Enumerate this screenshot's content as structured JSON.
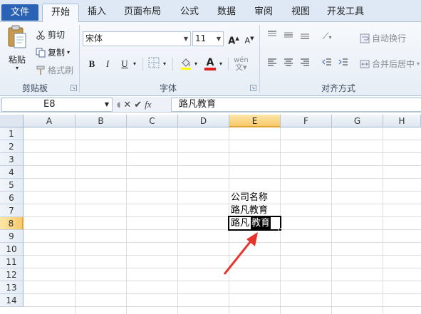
{
  "tabs": {
    "file": "文件",
    "home": "开始",
    "insert": "插入",
    "page_layout": "页面布局",
    "formulas": "公式",
    "data": "数据",
    "review": "审阅",
    "view": "视图",
    "developer": "开发工具"
  },
  "clipboard": {
    "paste": "粘贴",
    "cut": "剪切",
    "copy": "复制",
    "format_painter": "格式刷",
    "group_label": "剪贴板"
  },
  "font": {
    "name": "宋体",
    "size": "11",
    "group_label": "字体",
    "bold": "B",
    "italic": "I",
    "underline": "U",
    "grow": "A",
    "shrink": "A",
    "font_color_accent": "#e02020",
    "phonetic": "wén"
  },
  "alignment": {
    "wrap_text": "自动换行",
    "merge_center": "合并后居中",
    "group_label": "对齐方式"
  },
  "formula_bar": {
    "name_box": "E8",
    "fx": "fx",
    "content": "路凡教育"
  },
  "sheet": {
    "columns": [
      "A",
      "B",
      "C",
      "D",
      "E",
      "F",
      "G",
      "H"
    ],
    "rows": [
      "1",
      "2",
      "3",
      "4",
      "5",
      "6",
      "7",
      "8",
      "9",
      "10",
      "11",
      "12",
      "13",
      "14"
    ],
    "selected_column": "E",
    "selected_row": "8",
    "cells": {
      "E6": "公司名称",
      "E7": "路凡教育",
      "E8_plain": "路凡",
      "E8_selected": "教育"
    }
  },
  "annotation": {
    "arrow_color": "#e8332c"
  }
}
